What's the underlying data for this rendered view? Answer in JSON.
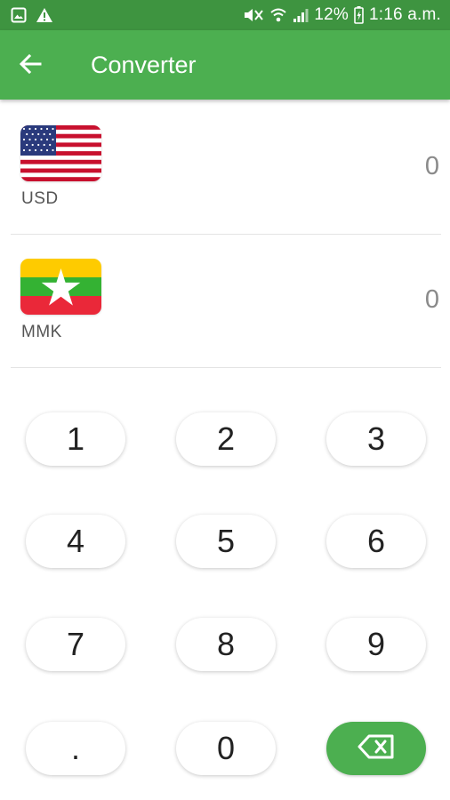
{
  "status_bar": {
    "battery": "12%",
    "time": "1:16 a.m.",
    "icons": [
      "image-icon",
      "alert-icon",
      "mute-icon",
      "wifi-icon",
      "signal-icon",
      "battery-icon"
    ]
  },
  "header": {
    "title": "Converter",
    "back_icon": "back-arrow-icon"
  },
  "currencies": [
    {
      "code": "USD",
      "value": "0",
      "flag": "us-flag"
    },
    {
      "code": "MMK",
      "value": "0",
      "flag": "myanmar-flag"
    }
  ],
  "keypad": {
    "keys": [
      "1",
      "2",
      "3",
      "4",
      "5",
      "6",
      "7",
      "8",
      "9",
      ".",
      "0"
    ],
    "backspace_icon": "backspace-icon"
  },
  "colors": {
    "status_bar": "#3e9440",
    "app_bar": "#4caf50",
    "accent": "#4caf50"
  }
}
